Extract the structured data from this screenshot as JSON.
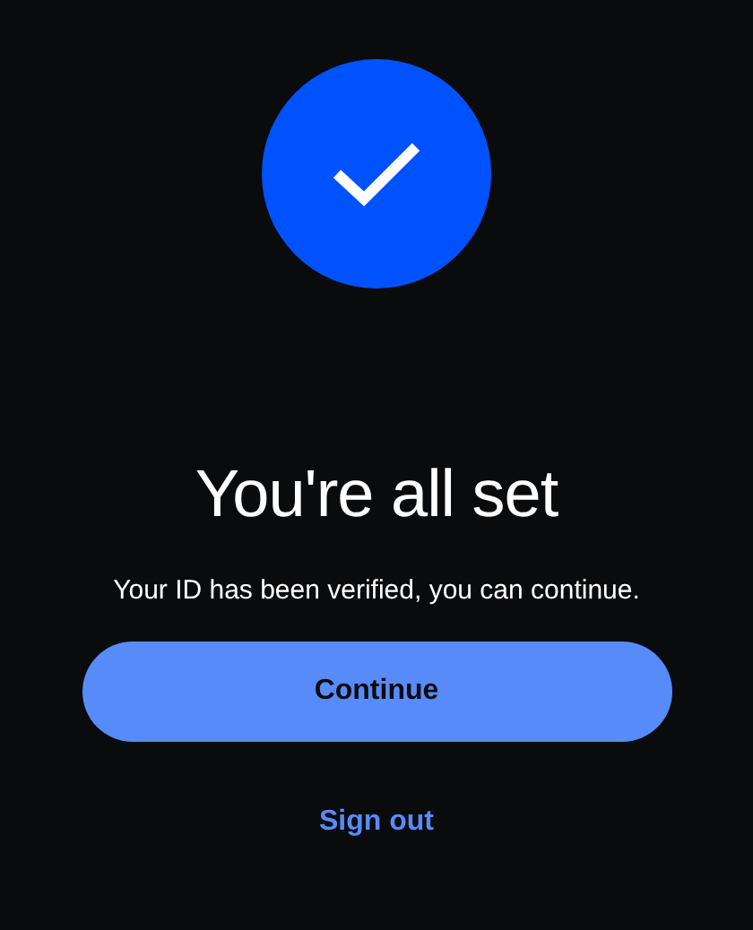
{
  "title": "You're all set",
  "message": "Your ID has been verified, you can continue.",
  "primary_button": "Continue",
  "secondary_link": "Sign out"
}
